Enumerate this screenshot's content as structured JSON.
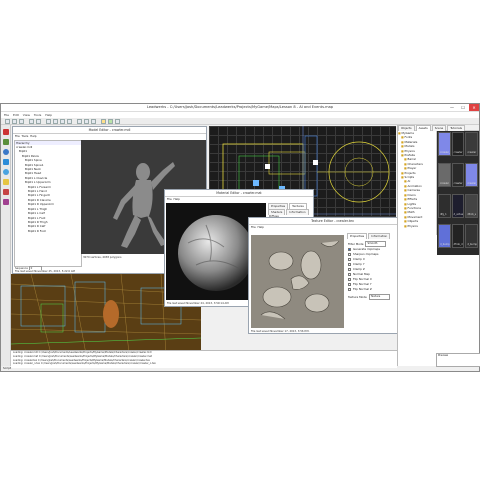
{
  "app": {
    "title": "Leadwerks - C:/Users/Josh/Documents/Leadwerks/Projects/MyGame/Maps/Lesson 8 - AI and Events.map",
    "menu": [
      "File",
      "Edit",
      "View",
      "Tools",
      "Help"
    ],
    "minimize": "—",
    "maximize": "☐",
    "close": "✕"
  },
  "viewports": {
    "perspective_label": "Perspective"
  },
  "model_editor": {
    "title": "Model Editor - crawler.mdl",
    "menu": [
      "File",
      "Tools",
      "Help"
    ],
    "hierarchy_label": "Hierarchy",
    "tree": [
      "crawler.mdl",
      "Bip01",
      "Bip01 Pelvis",
      "Bip01 Spine",
      "Bip01 Spine1",
      "Bip01 Neck",
      "Bip01 Head",
      "Bip01 L Clavicle",
      "Bip01 L UpperArm",
      "Bip01 L Forearm",
      "Bip01 L Hand",
      "Bip01 L Finger0",
      "Bip01 R Clavicle",
      "Bip01 R UpperArm",
      "Bip01 L Thigh",
      "Bip01 L Calf",
      "Bip01 L Foot",
      "Bip01 R Thigh",
      "Bip01 R Calf",
      "Bip01 R Foot"
    ],
    "sequence_label": "Sequence",
    "sequence_value": "0",
    "stats": "3070 vertices, 4038 polygons",
    "status": "File last saved November 25, 2013, 5:22:6 AM"
  },
  "material_editor": {
    "title": "Material Editor - crawler.mat",
    "menu": [
      "File",
      "Help"
    ],
    "tabs": [
      "Properties",
      "Textures",
      "Shaders",
      "Information"
    ],
    "diffuse_label": "Diffuse",
    "status": "File last saved November 24, 2013, 3:59:14 AM"
  },
  "texture_editor": {
    "title": "Texture Editor - crawler.tex",
    "menu": [
      "File",
      "Help"
    ],
    "tabs": [
      "Properties",
      "Information"
    ],
    "filter_mode_label": "Filter Mode",
    "filter_mode_value": "Smooth",
    "options": [
      {
        "label": "Generate mipmaps",
        "checked": true
      },
      {
        "label": "Sharpen mipmaps",
        "checked": false
      },
      {
        "label": "Clamp X",
        "checked": false
      },
      {
        "label": "Clamp Y",
        "checked": false
      },
      {
        "label": "Clamp Z",
        "checked": false
      },
      {
        "label": "Normal Map",
        "checked": false
      },
      {
        "label": "Flip Normal X",
        "checked": false
      },
      {
        "label": "Flip Normal Y",
        "checked": false
      },
      {
        "label": "Flip Normal Z",
        "checked": false
      }
    ],
    "texture_mode_label": "Texture Mode",
    "texture_mode_value": "Texture",
    "status": "File last saved November 17, 2013, 3:56 P.M."
  },
  "sidebar": {
    "tabs": [
      "Objects",
      "Assets",
      "Scene",
      "Tutorials"
    ],
    "root": "MyGame",
    "folders": [
      "Fonts",
      "Materials",
      "Models",
      "Physics",
      "Prefabs",
      "Barrel",
      "Characters",
      "Player",
      "Projects",
      "Scripts",
      "AI",
      "Animation",
      "Cameras",
      "Doors",
      "Effects",
      "Lights",
      "Functions",
      "Math",
      "Movement",
      "Objects",
      "Physics"
    ],
    "assets": [
      {
        "label": "crawler_n",
        "bg": "#7f88e8"
      },
      {
        "label": "crawler",
        "bg": "#222"
      },
      {
        "label": "crawler",
        "bg": "#3a3a3a"
      },
      {
        "label": "crawler",
        "bg": "#6a6a6a"
      },
      {
        "label": "crawler",
        "bg": "#2a2a2a"
      },
      {
        "label": "crawler_n",
        "bg": "#7f88e8"
      },
      {
        "label": "dfg_1",
        "bg": "#2e2e2e"
      },
      {
        "label": "d_actual",
        "bg": "#1e1e2e"
      },
      {
        "label": "dfrob_s",
        "bg": "#444"
      },
      {
        "label": "d_bump",
        "bg": "#6070d8"
      },
      {
        "label": "dfrob_d",
        "bg": "#222"
      },
      {
        "label": "d_bump_b",
        "bg": "#333"
      }
    ],
    "preview_label": "Preview"
  },
  "console": {
    "lines": [
      "Loading: crawler.mdl  C:/Users/Josh/Documents/Leadwerks/Projects/MyGame/Models/Characters/crawler/crawler.mdl",
      "Loading: crawler.mat  C:/Users/Josh/Documents/Leadwerks/Projects/MyGame/Models/Characters/crawler/crawler.mat",
      "Loading: crawler.tex  C:/Users/Josh/Documents/Leadwerks/Projects/MyGame/Models/Characters/crawler/crawler.tex",
      "Loading: crawler_n.tex  C:/Users/Josh/Documents/Leadwerks/Projects/MyGame/Models/Characters/crawler/crawler_n.tex"
    ],
    "script_label": "Script"
  }
}
